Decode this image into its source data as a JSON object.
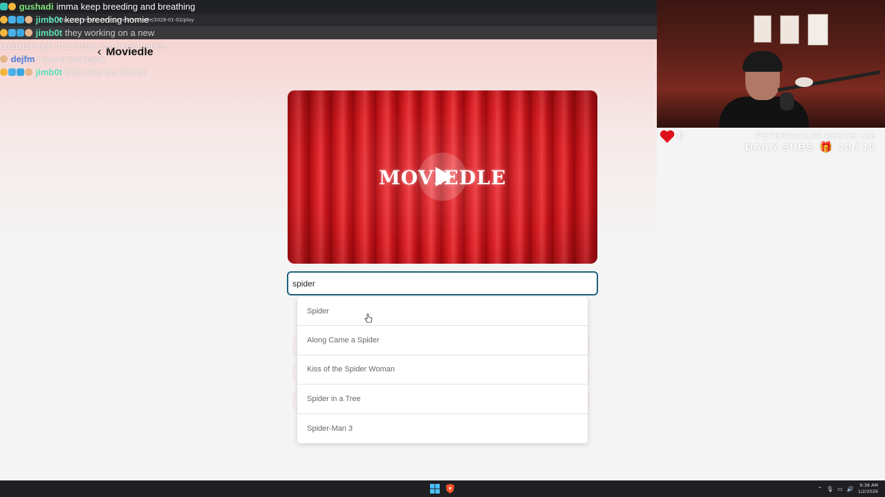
{
  "browser": {
    "url": "https://pix-media.com/games/moviedle/2026-01-02/play"
  },
  "app": {
    "title": "Moviedle",
    "video_logo": "MOVIEDLE"
  },
  "search": {
    "value": "spider"
  },
  "dropdown": {
    "items": [
      {
        "label": "Spider"
      },
      {
        "label": "Along Came a Spider"
      },
      {
        "label": "Kiss of the Spider Woman"
      },
      {
        "label": "Spider in a Tree"
      },
      {
        "label": "Spider-Man 3"
      }
    ]
  },
  "chat": {
    "messages": [
      {
        "user": "gushadi",
        "user_color": "#7fe27c",
        "message": "imma keep breeding and breathing"
      },
      {
        "user": "jimb0t",
        "user_color": "#5de0b6",
        "message": "keep breeding homie"
      },
      {
        "user": "jimb0t",
        "user_color": "#5de0b6",
        "message": "they working on a new breakthrough that bussy can make babies"
      },
      {
        "user": "dejfm",
        "user_color": "#4a7ad6",
        "message": "i saw a red mask"
      },
      {
        "user": "jimb0t",
        "user_color": "#5de0b6",
        "message": "thats way too fast lol"
      }
    ]
  },
  "stream_overlay": {
    "heart_count": "0",
    "promo": "PETERPARLAY.RESUB x16",
    "daily_subs_label": "DAILY SUBS",
    "daily_subs_value": "10 / 10"
  },
  "taskbar": {
    "time": "9:38 AM",
    "date": "1/2/2026"
  },
  "colors": {
    "accent_border": "#1b5f7a",
    "curtain_red": "#e3232a",
    "heart_red": "#e0101b"
  }
}
